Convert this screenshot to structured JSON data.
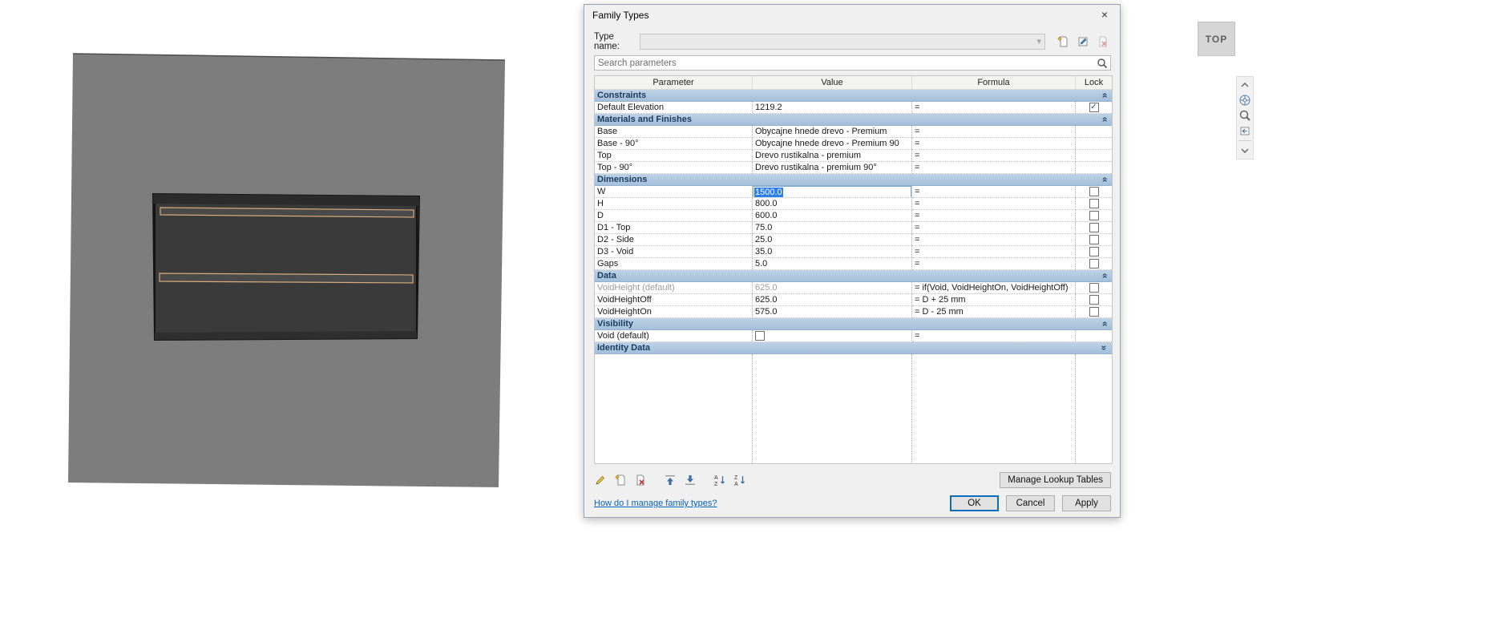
{
  "icons": {
    "close": "×",
    "combo_arrow": "▾",
    "collapse_chevron": "»",
    "check": "✓"
  },
  "viewcube": {
    "label": "TOP"
  },
  "dialog": {
    "title": "Family Types",
    "type_name": {
      "label": "Type name:",
      "value": ""
    },
    "search": {
      "placeholder": "Search parameters"
    },
    "columns": [
      "Parameter",
      "Value",
      "Formula",
      "Lock"
    ],
    "sections": [
      {
        "name": "Constraints",
        "rows": [
          {
            "param": "Default Elevation",
            "value": "1219.2",
            "formula": "=",
            "lock": "checked"
          }
        ]
      },
      {
        "name": "Materials and Finishes",
        "rows": [
          {
            "param": "Base",
            "value": "Obycajne hnede drevo - Premium",
            "formula": "="
          },
          {
            "param": "Base - 90°",
            "value": "Obycajne hnede drevo - Premium 90",
            "formula": "="
          },
          {
            "param": "Top",
            "value": "Drevo rustikalna - premium",
            "formula": "="
          },
          {
            "param": "Top - 90°",
            "value": "Drevo rustikalna - premium 90°",
            "formula": "="
          }
        ]
      },
      {
        "name": "Dimensions",
        "rows": [
          {
            "param": "W",
            "value": "1500.0",
            "formula": "=",
            "lock": "unchecked",
            "selected": true
          },
          {
            "param": "H",
            "value": "800.0",
            "formula": "=",
            "lock": "unchecked"
          },
          {
            "param": "D",
            "value": "600.0",
            "formula": "=",
            "lock": "unchecked"
          },
          {
            "param": "D1 - Top",
            "value": "75.0",
            "formula": "=",
            "lock": "unchecked"
          },
          {
            "param": "D2 - Side",
            "value": "25.0",
            "formula": "=",
            "lock": "unchecked"
          },
          {
            "param": "D3 - Void",
            "value": "35.0",
            "formula": "=",
            "lock": "unchecked"
          },
          {
            "param": "Gaps",
            "value": "5.0",
            "formula": "=",
            "lock": "unchecked"
          }
        ]
      },
      {
        "name": "Data",
        "rows": [
          {
            "param": "VoidHeight (default)",
            "value": "625.0",
            "formula": "= if(Void, VoidHeightOn, VoidHeightOff)",
            "lock": "unchecked",
            "disabled": true
          },
          {
            "param": "VoidHeightOff",
            "value": "625.0",
            "formula": "= D + 25 mm",
            "lock": "unchecked"
          },
          {
            "param": "VoidHeightOn",
            "value": "575.0",
            "formula": "= D - 25 mm",
            "lock": "unchecked"
          }
        ]
      },
      {
        "name": "Visibility",
        "rows": [
          {
            "param": "Void (default)",
            "value_checkbox": "unchecked",
            "formula": "="
          }
        ]
      },
      {
        "name": "Identity Data",
        "collapsed": true,
        "rows": []
      }
    ],
    "footer": {
      "manage_lookup": "Manage Lookup Tables",
      "help_link": "How do I manage family types?",
      "ok": "OK",
      "cancel": "Cancel",
      "apply": "Apply"
    }
  }
}
